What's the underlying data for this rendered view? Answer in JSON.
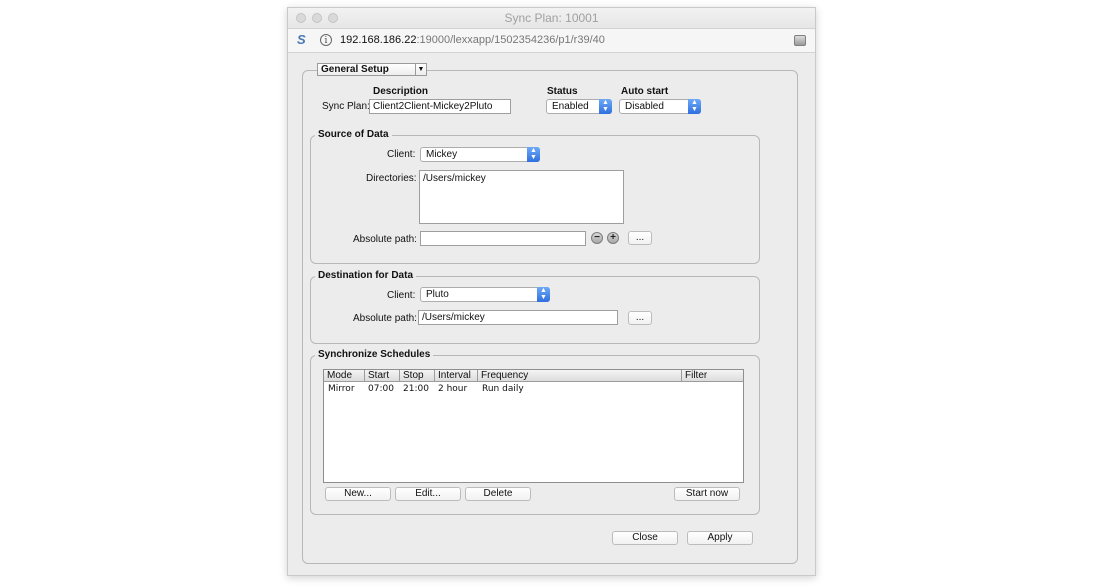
{
  "window": {
    "title": "Sync Plan: 10001"
  },
  "address_bar": {
    "host": "192.168.186.22",
    "path": ":19000/lexxapp/1502354236/p1/r39/40"
  },
  "setup": {
    "mode_selector": "General Setup",
    "columns": {
      "description": "Description",
      "status": "Status",
      "auto_start": "Auto start"
    },
    "sync_plan_label": "Sync Plan:",
    "sync_plan_value": "Client2Client-Mickey2Pluto",
    "status_value": "Enabled",
    "auto_start_value": "Disabled"
  },
  "source": {
    "title": "Source of Data",
    "client_label": "Client:",
    "client_value": "Mickey",
    "directories_label": "Directories:",
    "directories": [
      "/Users/mickey"
    ],
    "abs_path_label": "Absolute path:",
    "abs_path_value": "",
    "minus": "−",
    "plus": "+",
    "browse": "..."
  },
  "destination": {
    "title": "Destination for Data",
    "client_label": "Client:",
    "client_value": "Pluto",
    "abs_path_label": "Absolute path:",
    "abs_path_value": "/Users/mickey",
    "browse": "..."
  },
  "schedules": {
    "title": "Synchronize Schedules",
    "headers": [
      "Mode",
      "Start",
      "Stop",
      "Interval",
      "Frequency",
      "Filter"
    ],
    "rows": [
      {
        "mode": "Mirror",
        "start": "07:00",
        "stop": "21:00",
        "interval": "2 hour",
        "frequency": "Run daily",
        "filter": ""
      }
    ],
    "buttons": {
      "new": "New...",
      "edit": "Edit...",
      "delete": "Delete",
      "start_now": "Start now"
    }
  },
  "footer": {
    "close": "Close",
    "apply": "Apply"
  },
  "colors": {
    "accent": "#2f6fe0",
    "window_bg": "#ececec"
  },
  "icons": [
    "s-logo-icon",
    "info-icon",
    "drive-icon",
    "minus-icon",
    "plus-icon",
    "select-arrows-icon"
  ]
}
